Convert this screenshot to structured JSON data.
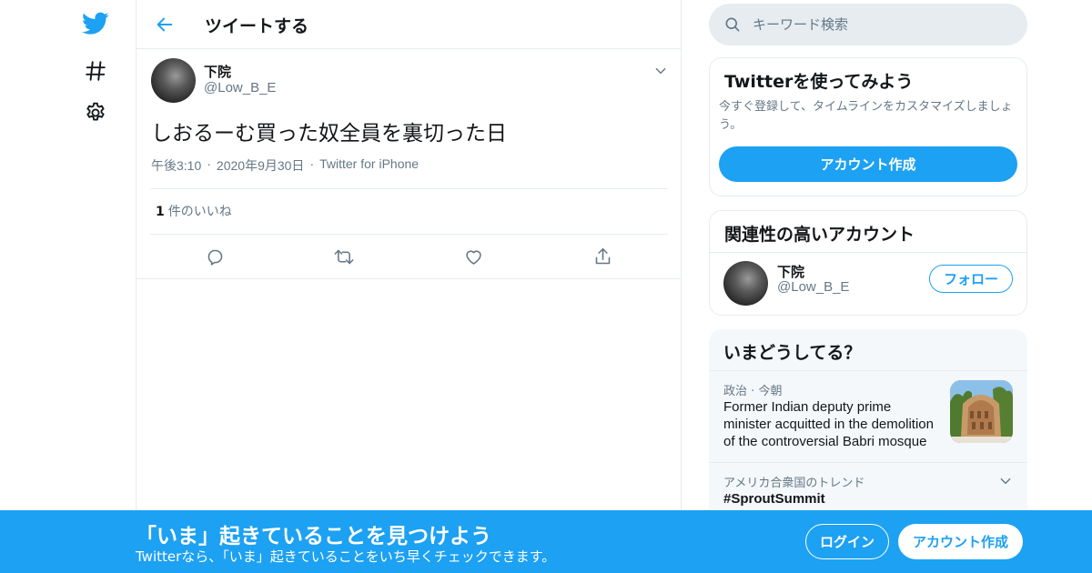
{
  "nav": {
    "icons": [
      "twitter-bird-icon",
      "hashtag-icon",
      "settings-icon"
    ]
  },
  "header": {
    "title": "ツイートする"
  },
  "tweet": {
    "display_name": "下院",
    "handle": "@Low_B_E",
    "text": "しおるーむ買った奴全員を裏切った日",
    "time": "午後3:10",
    "date": "2020年9月30日",
    "source": "Twitter for iPhone",
    "like_count": "1",
    "like_label": "件のいいね",
    "separator": "·"
  },
  "search": {
    "placeholder": "キーワード検索"
  },
  "signup_card": {
    "title": "Twitterを使ってみよう",
    "description": "今すぐ登録して、タイムラインをカスタマイズしましょう。",
    "button": "アカウント作成"
  },
  "related_card": {
    "title": "関連性の高いアカウント",
    "account_name": "下院",
    "account_handle": "@Low_B_E",
    "follow_button": "フォロー"
  },
  "trends": {
    "title": "いまどうしてる？",
    "items": [
      {
        "category": "政治",
        "time": "今朝",
        "headline": "Former Indian deputy prime minister acquitted in the demolition of the controversial Babri mosque"
      },
      {
        "category": "アメリカ合衆国のトレンド",
        "tag": "#SproutSummit"
      }
    ]
  },
  "banner": {
    "title": "「いま」起きていることを見つけよう",
    "subtitle": "Twitterなら、「いま」起きていることをいち早くチェックできます。",
    "login": "ログイン",
    "signup": "アカウント作成"
  },
  "colors": {
    "accent": "#1da1f2",
    "text": "#14171a",
    "secondary": "#657786",
    "border": "#e6ecf0",
    "sidebar_bg": "#f5f8fa"
  }
}
